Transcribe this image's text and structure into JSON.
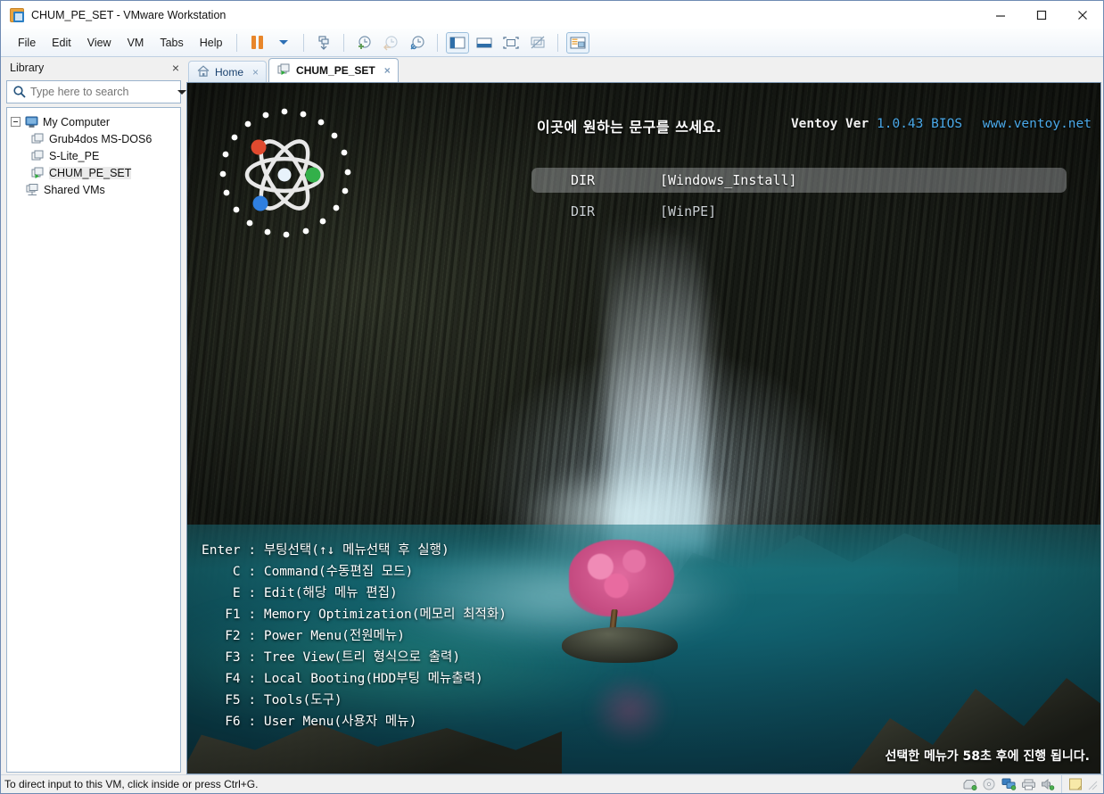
{
  "window": {
    "title": "CHUM_PE_SET - VMware Workstation",
    "app_icon": "vmware-icon",
    "minimize": "minimize-icon",
    "maximize": "maximize-icon",
    "close": "close-icon"
  },
  "menubar": {
    "items": [
      "File",
      "Edit",
      "View",
      "VM",
      "Tabs",
      "Help"
    ],
    "toolbar": [
      {
        "name": "pause-button",
        "glyph": "pause"
      },
      {
        "name": "power-dropdown-button",
        "glyph": "caret"
      },
      {
        "name": "snapshot-button",
        "glyph": "snapshot"
      },
      {
        "name": "take-snapshot-button",
        "glyph": "clock-plus"
      },
      {
        "name": "revert-snapshot-button",
        "glyph": "clock-back"
      },
      {
        "name": "snapshot-manager-button",
        "glyph": "clock-wrench"
      },
      {
        "name": "show-library-button",
        "glyph": "sidebar"
      },
      {
        "name": "show-console-view-button",
        "glyph": "console"
      },
      {
        "name": "fullscreen-button",
        "glyph": "fullscreen"
      },
      {
        "name": "unity-mode-button",
        "glyph": "unity"
      },
      {
        "name": "show-thumbnail-bar-button",
        "glyph": "thumbnails"
      }
    ]
  },
  "library": {
    "title": "Library",
    "close_label": "×",
    "search": {
      "placeholder": "Type here to search",
      "value": ""
    },
    "tree": [
      {
        "label": "My Computer",
        "icon": "computer-icon",
        "level": 0,
        "selected": false
      },
      {
        "label": "Grub4dos MS-DOS6",
        "icon": "vm-icon",
        "level": 1,
        "selected": false
      },
      {
        "label": "S-Lite_PE",
        "icon": "vm-icon",
        "level": 1,
        "selected": false
      },
      {
        "label": "CHUM_PE_SET",
        "icon": "vm-running-icon",
        "level": 1,
        "selected": true
      },
      {
        "label": "Shared VMs",
        "icon": "shared-vms-icon",
        "level": 0.5,
        "selected": false
      }
    ]
  },
  "tabs": [
    {
      "label": "Home",
      "icon": "home-icon",
      "active": false,
      "close": "×"
    },
    {
      "label": "CHUM_PE_SET",
      "icon": "vm-icon",
      "active": true,
      "close": "×"
    }
  ],
  "ventoy": {
    "message": "이곳에 원하는 문구를 쓰세요.",
    "version_label": "Ventoy Ver",
    "version_number": "1.0.43",
    "firmware": "BIOS",
    "url": "www.ventoy.net",
    "logo": "ventoy-atom-logo",
    "logo_colors": {
      "red": "#e04a2f",
      "green": "#33b04a",
      "blue": "#2f7fe0",
      "core": "#e8f2fb",
      "ring": "#e6e6e6"
    },
    "entries": [
      {
        "type": "DIR",
        "name": "[Windows_Install]",
        "selected": true
      },
      {
        "type": "DIR",
        "name": "[WinPE]",
        "selected": false
      }
    ],
    "help_lines": [
      "Enter : 부팅선택(↑↓ 메뉴선택 후 실행)",
      "    C : Command(수동편집 모드)",
      "    E : Edit(해당 메뉴 편집)",
      "   F1 : Memory Optimization(메모리 최적화)",
      "   F2 : Power Menu(전원메뉴)",
      "   F3 : Tree View(트리 형식으로 출력)",
      "   F4 : Local Booting(HDD부팅 메뉴출력)",
      "   F5 : Tools(도구)",
      "   F6 : User Menu(사용자 메뉴)"
    ],
    "countdown": "선택한 메뉴가 58초 후에 진행 됩니다.",
    "countdown_seconds": "58"
  },
  "statusbar": {
    "text": "To direct input to this VM, click inside or press Ctrl+G.",
    "icons": [
      {
        "name": "hard-disk-status-icon"
      },
      {
        "name": "cd-dvd-status-icon"
      },
      {
        "name": "network-status-icon"
      },
      {
        "name": "printer-status-icon"
      },
      {
        "name": "sound-status-icon"
      },
      {
        "name": "notes-status-icon"
      }
    ]
  }
}
